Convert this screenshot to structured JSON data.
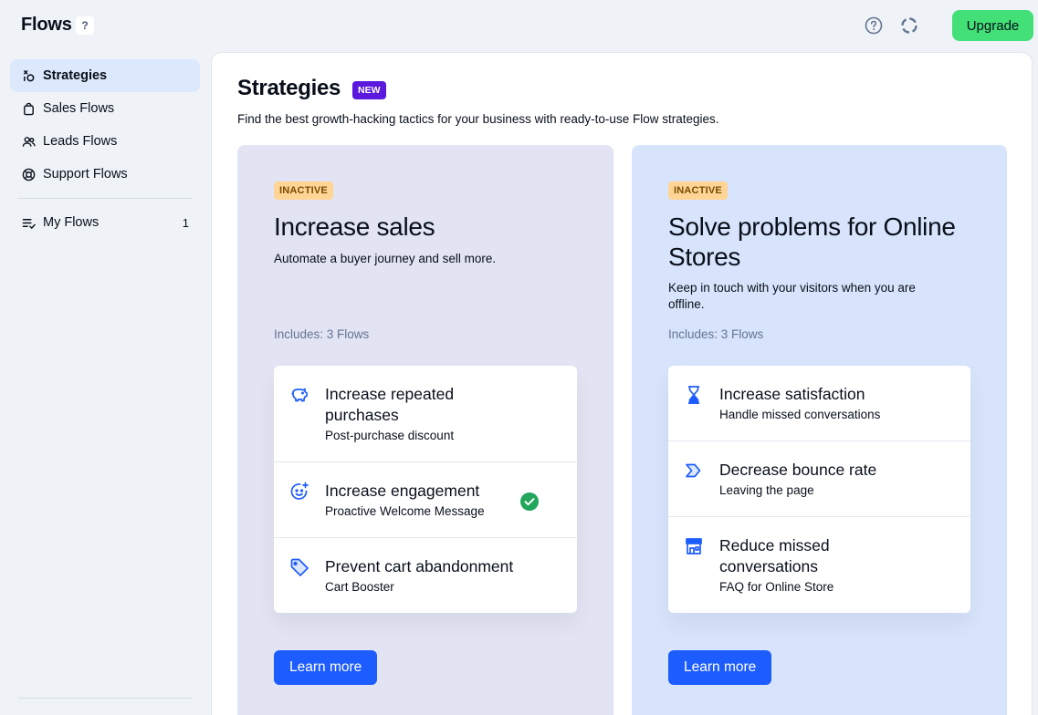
{
  "header": {
    "title": "Flows",
    "help_badge": "?",
    "upgrade_label": "Upgrade",
    "help_icon": "question-circle-icon",
    "loader_icon": "loader-icon"
  },
  "sidebar": {
    "items": [
      {
        "label": "Strategies",
        "icon": "strategies-icon",
        "active": true
      },
      {
        "label": "Sales Flows",
        "icon": "shopping-bag-icon"
      },
      {
        "label": "Leads Flows",
        "icon": "users-icon"
      },
      {
        "label": "Support Flows",
        "icon": "lifebuoy-icon"
      }
    ],
    "my_flows": {
      "label": "My Flows",
      "icon": "list-check-icon",
      "count": "1"
    }
  },
  "main": {
    "title": "Strategies",
    "badge": "NEW",
    "subtitle": "Find the best growth-hacking tactics for your business with ready-to-use Flow strategies.",
    "cards": [
      {
        "status": "INACTIVE",
        "title": "Increase sales",
        "description": "Automate a buyer journey and sell more.",
        "includes": "Includes: 3 Flows",
        "flows": [
          {
            "name": "Increase repeated purchases",
            "sub": "Post-purchase discount",
            "icon": "piggy-bank-icon"
          },
          {
            "name": "Increase engagement",
            "sub": "Proactive Welcome Message",
            "icon": "smiley-plus-icon",
            "check_icon": "check-circle-icon"
          },
          {
            "name": "Prevent cart abandonment",
            "sub": "Cart Booster",
            "icon": "tag-icon"
          }
        ],
        "button": "Learn more"
      },
      {
        "status": "INACTIVE",
        "title": "Solve problems for Online Stores",
        "description": "Keep in touch with your visitors when you are offline.",
        "includes": "Includes: 3 Flows",
        "flows": [
          {
            "name": "Increase satisfaction",
            "sub": "Handle missed conversations",
            "icon": "hourglass-icon"
          },
          {
            "name": "Decrease bounce rate",
            "sub": "Leaving the page",
            "icon": "chevron-arrow-icon"
          },
          {
            "name": "Reduce missed conversations",
            "sub": "FAQ for Online Store",
            "icon": "storefront-icon"
          }
        ],
        "button": "Learn more"
      }
    ]
  },
  "colors": {
    "accent": "#1d5cff",
    "upgrade": "#42e077",
    "new_badge": "#5a19dc",
    "inactive_badge": "#ffd596",
    "check": "#21a65c"
  }
}
